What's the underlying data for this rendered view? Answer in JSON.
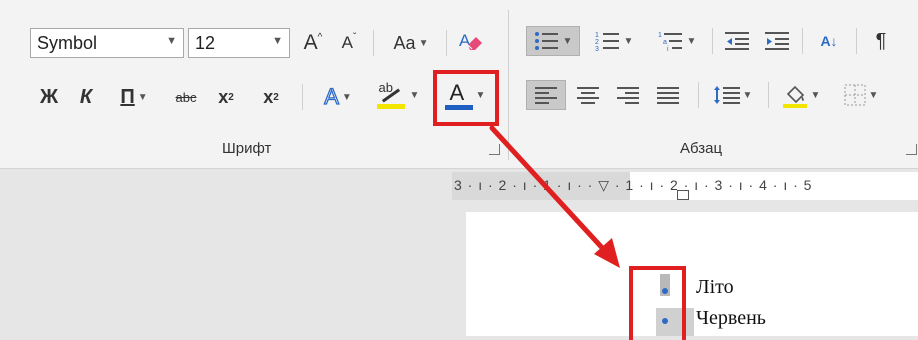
{
  "font_group": {
    "font_name": "Symbol",
    "font_size": "12",
    "grow_font_glyph": "A",
    "shrink_font_glyph": "A",
    "change_case_glyph": "Aa",
    "bold_glyph": "Ж",
    "italic_glyph": "К",
    "underline_glyph": "П",
    "strike_glyph": "abc",
    "subscript_glyph": "x",
    "subscript_mark": "2",
    "superscript_glyph": "x",
    "superscript_mark": "2",
    "text_effects_glyph": "A",
    "highlight_glyph": "ab",
    "font_color_glyph": "A",
    "label": "Шрифт"
  },
  "paragraph_group": {
    "sort_glyph": "А↓",
    "pilcrow_glyph": "¶",
    "label": "Абзац"
  },
  "ruler": {
    "text": "3 · ı · 2 · ı · 1 · ı ·   · ▽ · 1 · ı · 2 · ı · 3 · ı · 4 · ı · 5"
  },
  "document": {
    "items": [
      "Літо",
      "Червень"
    ]
  },
  "colors": {
    "accent_red": "#e02020",
    "font_color_bar": "#1f5fc2",
    "highlight_bar": "#f2e600",
    "bullet_blue": "#2e6bc6"
  }
}
